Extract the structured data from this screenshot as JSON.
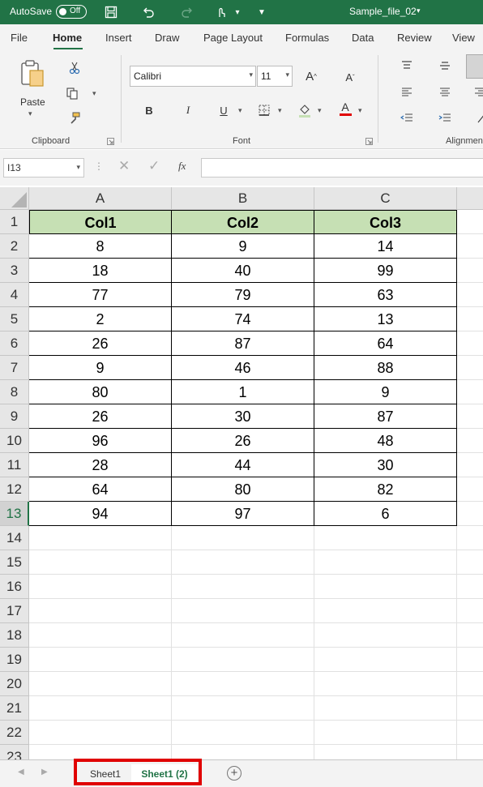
{
  "titlebar": {
    "autosave_label": "AutoSave",
    "autosave_state": "Off",
    "file_name": "Sample_file_02"
  },
  "ribbon": {
    "tabs": [
      "File",
      "Home",
      "Insert",
      "Draw",
      "Page Layout",
      "Formulas",
      "Data",
      "Review",
      "View"
    ],
    "active_tab": "Home",
    "groups": {
      "clipboard": {
        "label": "Clipboard",
        "paste_label": "Paste"
      },
      "font": {
        "label": "Font",
        "font_name": "Calibri",
        "font_size": "11",
        "bold": "B",
        "italic": "I",
        "underline": "U"
      },
      "alignment": {
        "label": "Alignmen"
      }
    }
  },
  "formula_bar": {
    "name_box": "I13",
    "fx": "fx",
    "value": ""
  },
  "sheet": {
    "columns": [
      "A",
      "B",
      "C"
    ],
    "rows": [
      "1",
      "2",
      "3",
      "4",
      "5",
      "6",
      "7",
      "8",
      "9",
      "10",
      "11",
      "12",
      "13",
      "14",
      "15",
      "16",
      "17",
      "18",
      "19",
      "20",
      "21",
      "22",
      "23"
    ],
    "selected_row": "13",
    "header": [
      "Col1",
      "Col2",
      "Col3"
    ],
    "data": [
      [
        "8",
        "9",
        "14"
      ],
      [
        "18",
        "40",
        "99"
      ],
      [
        "77",
        "79",
        "63"
      ],
      [
        "2",
        "74",
        "13"
      ],
      [
        "26",
        "87",
        "64"
      ],
      [
        "9",
        "46",
        "88"
      ],
      [
        "80",
        "1",
        "9"
      ],
      [
        "26",
        "30",
        "87"
      ],
      [
        "96",
        "26",
        "48"
      ],
      [
        "28",
        "44",
        "30"
      ],
      [
        "64",
        "80",
        "82"
      ],
      [
        "94",
        "97",
        "6"
      ]
    ]
  },
  "sheet_tabs": {
    "tabs": [
      "Sheet1",
      "Sheet1 (2)"
    ],
    "active": "Sheet1 (2)",
    "add_label": "+"
  },
  "colors": {
    "brand": "#217346",
    "header_fill": "#c6e0b4",
    "highlight_box": "#e00000"
  }
}
